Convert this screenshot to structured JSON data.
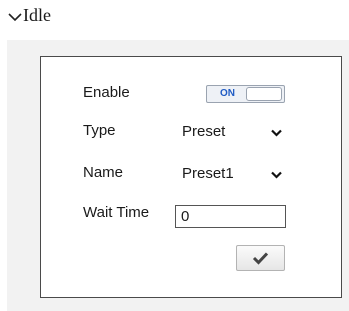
{
  "section": {
    "title": "Idle",
    "collapse_icon": "chevron-down-icon"
  },
  "form": {
    "enable": {
      "label": "Enable",
      "toggle_text": "ON",
      "checked": true
    },
    "type": {
      "label": "Type",
      "value": "Preset"
    },
    "name": {
      "label": "Name",
      "value": "Preset1"
    },
    "wait_time": {
      "label": "Wait Time",
      "value": "0"
    },
    "confirm_icon": "checkmark-icon"
  },
  "colors": {
    "panel_background": "#f2f2f2",
    "toggle_text": "#1f5bc4",
    "border": "#4a4a4a"
  }
}
